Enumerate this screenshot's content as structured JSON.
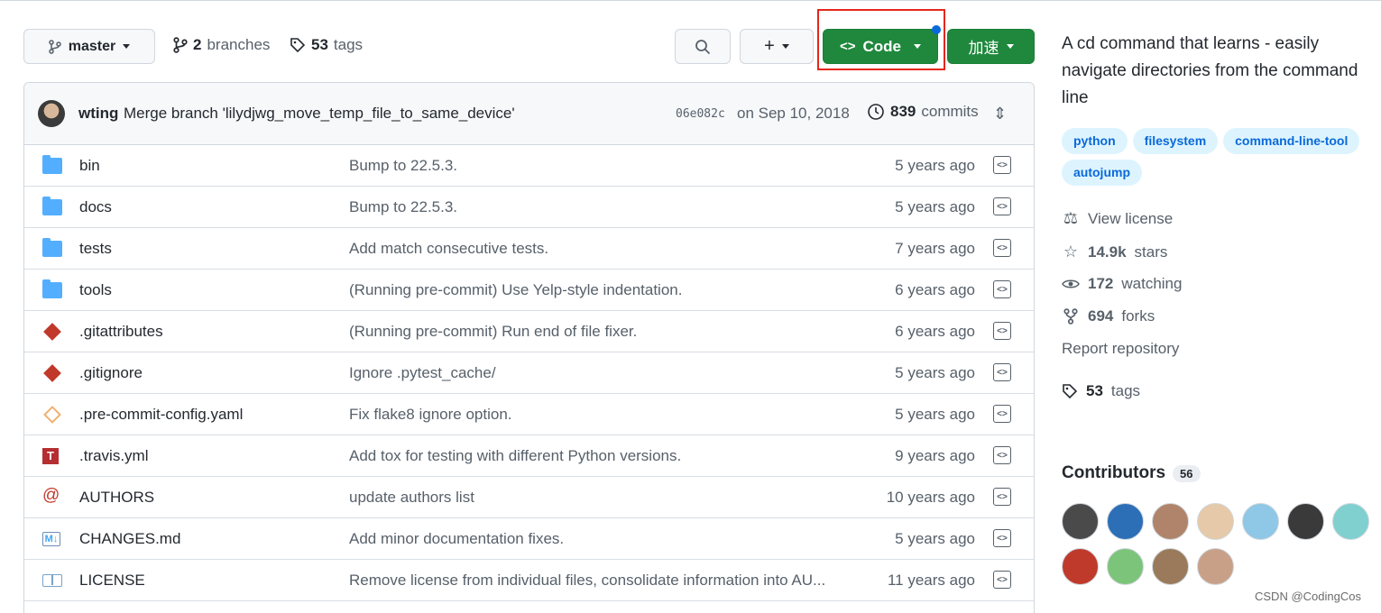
{
  "toolbar": {
    "branch": "master",
    "branches_count": "2",
    "branches_label": "branches",
    "tags_count": "53",
    "tags_label": "tags",
    "plus_label": "+",
    "code_label": "Code",
    "speed_label": "加速"
  },
  "commit": {
    "author": "wting",
    "message": "Merge branch 'lilydjwg_move_temp_file_to_same_device'",
    "hash": "06e082c",
    "date": "on Sep 10, 2018",
    "count": "839",
    "count_label": "commits"
  },
  "files": [
    {
      "name": "bin",
      "type": "folder",
      "message": "Bump to 22.5.3.",
      "age": "5 years ago"
    },
    {
      "name": "docs",
      "type": "folder",
      "message": "Bump to 22.5.3.",
      "age": "5 years ago"
    },
    {
      "name": "tests",
      "type": "folder",
      "message": "Add match consecutive tests.",
      "age": "7 years ago"
    },
    {
      "name": "tools",
      "type": "folder",
      "message": "(Running pre-commit) Use Yelp-style indentation.",
      "age": "6 years ago"
    },
    {
      "name": ".gitattributes",
      "type": "git",
      "message": "(Running pre-commit) Run end of file fixer.",
      "age": "6 years ago"
    },
    {
      "name": ".gitignore",
      "type": "git",
      "message": "Ignore .pytest_cache/",
      "age": "5 years ago"
    },
    {
      "name": ".pre-commit-config.yaml",
      "type": "pre-commit",
      "message": "Fix flake8 ignore option.",
      "age": "5 years ago"
    },
    {
      "name": ".travis.yml",
      "type": "travis",
      "message": "Add tox for testing with different Python versions.",
      "age": "9 years ago"
    },
    {
      "name": "AUTHORS",
      "type": "at",
      "message": "update authors list",
      "age": "10 years ago"
    },
    {
      "name": "CHANGES.md",
      "type": "markdown",
      "message": "Add minor documentation fixes.",
      "age": "5 years ago"
    },
    {
      "name": "LICENSE",
      "type": "book",
      "message": "Remove license from individual files, consolidate information into AU...",
      "age": "11 years ago"
    }
  ],
  "sidebar": {
    "about": "A cd command that learns - easily navigate directories from the command line",
    "topics": [
      "python",
      "filesystem",
      "command-line-tool",
      "autojump"
    ],
    "view_license": "View license",
    "stars_count": "14.9k",
    "stars_label": "stars",
    "watching_count": "172",
    "watching_label": "watching",
    "forks_count": "694",
    "forks_label": "forks",
    "report": "Report repository",
    "tags_count": "53",
    "tags_label": "tags",
    "contributors_title": "Contributors",
    "contributors_count": "56"
  },
  "avatar_colors": [
    "#4a4a4a",
    "#2c6fb7",
    "#b0846a",
    "#e6c9a8",
    "#8fc7e6",
    "#3a3a3a",
    "#7fd0cf",
    "#c03a2b",
    "#7cc47a",
    "#9a7a5a",
    "#c8a088"
  ],
  "watermark": "CSDN @CodingCos"
}
